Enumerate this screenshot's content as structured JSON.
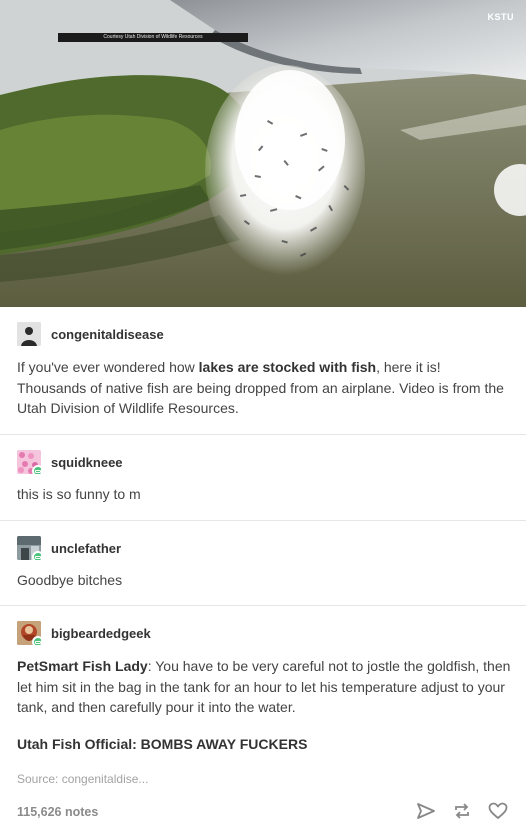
{
  "photo": {
    "watermark": "KSTU",
    "credit": "Courtesy Utah Division of Wildlife Resources"
  },
  "op": {
    "username": "congenitaldisease",
    "text_before": "If you've ever wondered how ",
    "text_bold": "lakes are stocked with fish",
    "text_after": ", here it is! Thousands of native fish are being dropped from an airplane. Video is from the Utah Division of Wildlife Resources."
  },
  "reblogs": [
    {
      "username": "squidkneee",
      "text": "this is so funny to m"
    },
    {
      "username": "unclefather",
      "text": "Goodbye bitches"
    },
    {
      "username": "bigbeardedgeek",
      "speaker1": "PetSmart Fish Lady",
      "line1": ":  You have to be very careful not to jostle the goldfish, then let him sit in the bag in the tank for an hour to let his temperature adjust to your tank, and then carefully pour it into the water.",
      "speaker2": "Utah Fish Official",
      "line2": ": BOMBS AWAY FUCKERS"
    }
  ],
  "footer": {
    "source": "Source:  congenitaldise...",
    "notes": "115,626 notes"
  },
  "icons": {
    "share": "share-icon",
    "reblog": "reblog-icon",
    "like": "heart-icon"
  },
  "colors": {
    "text": "#444444",
    "follow_badge": "#4cc37a",
    "muted": "#a3a3a3"
  }
}
